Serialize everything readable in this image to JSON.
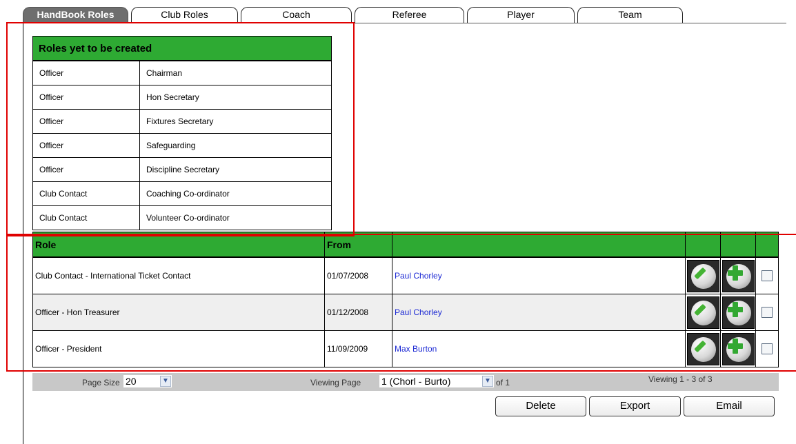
{
  "tabs": [
    {
      "label": "HandBook Roles",
      "active": true
    },
    {
      "label": "Club Roles",
      "active": false
    },
    {
      "label": "Coach",
      "active": false
    },
    {
      "label": "Referee",
      "active": false
    },
    {
      "label": "Player",
      "active": false
    },
    {
      "label": "Team",
      "active": false
    }
  ],
  "pending_roles": {
    "title": "Roles yet to be created",
    "rows": [
      [
        "Officer",
        "Chairman"
      ],
      [
        "Officer",
        "Hon Secretary"
      ],
      [
        "Officer",
        "Fixtures Secretary"
      ],
      [
        "Officer",
        "Safeguarding"
      ],
      [
        "Officer",
        "Discipline Secretary"
      ],
      [
        "Club Contact",
        "Coaching Co-ordinator"
      ],
      [
        "Club Contact",
        "Volunteer Co-ordinator"
      ]
    ]
  },
  "roles_table": {
    "headers": {
      "role": "Role",
      "from": "From"
    },
    "rows": [
      {
        "role": "Club Contact - International Ticket Contact",
        "from": "01/07/2008",
        "person": "Paul Chorley"
      },
      {
        "role": "Officer - Hon Treasurer",
        "from": "01/12/2008",
        "person": "Paul Chorley"
      },
      {
        "role": "Officer - President",
        "from": "11/09/2009",
        "person": "Max Burton"
      }
    ],
    "row_icons": [
      "pencil-icon",
      "plus-icon"
    ]
  },
  "pager": {
    "page_size_label": "Page Size",
    "page_size_value": "20",
    "viewing_page_label": "Viewing Page",
    "viewing_page_value": "1 (Chorl - Burto)",
    "of_label": "of 1",
    "viewing_range": "Viewing  1 - 3 of 3"
  },
  "actions": {
    "delete": "Delete",
    "export": "Export",
    "email": "Email"
  },
  "colors": {
    "header_green": "#2eaa33",
    "link_blue": "#1d2ad4",
    "highlight_red": "#e00000",
    "active_tab": "#6e6e6e"
  }
}
